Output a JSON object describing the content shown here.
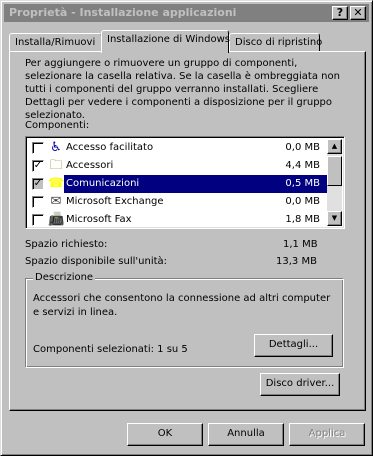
{
  "window": {
    "title": "Proprietà - Installazione applicazioni",
    "help_glyph": "?",
    "close_glyph": "✕"
  },
  "tabs": [
    {
      "label": "Installa/Rimuovi",
      "active": false
    },
    {
      "label": "Installazione di Windows",
      "active": true
    },
    {
      "label": "Disco di ripristino",
      "active": false
    }
  ],
  "intro_text": "Per aggiungere o rimuovere un gruppo di componenti, selezionare la casella relativa. Se la casella è ombreggiata non tutti i componenti del gruppo verranno installati. Scegliere Dettagli per vedere i componenti a disposizione per il gruppo selezionato.",
  "components_label": "Componenti:",
  "components": [
    {
      "name": "Accesso facilitato",
      "size": "0,0 MB",
      "checked": false,
      "icon": "accessibility-icon",
      "glyph": "♿",
      "selected": false
    },
    {
      "name": "Accessori",
      "size": "4,4 MB",
      "checked": true,
      "icon": "folder-icon",
      "glyph": "🗀",
      "selected": false
    },
    {
      "name": "Comunicazioni",
      "size": "0,5 MB",
      "checked": true,
      "icon": "communications-icon",
      "glyph": "☎",
      "selected": true
    },
    {
      "name": "Microsoft Exchange",
      "size": "0,0 MB",
      "checked": false,
      "icon": "exchange-icon",
      "glyph": "✉",
      "selected": false
    },
    {
      "name": "Microsoft Fax",
      "size": "1,8 MB",
      "checked": false,
      "icon": "fax-icon",
      "glyph": "📠",
      "selected": false
    }
  ],
  "check_glyph": "✓",
  "scroll": {
    "up_glyph": "▲",
    "down_glyph": "▼"
  },
  "space": {
    "required_label": "Spazio richiesto:",
    "required_value": "1,1 MB",
    "available_label": "Spazio disponibile sull'unità:",
    "available_value": "13,3 MB"
  },
  "description": {
    "legend": "Descrizione",
    "text": "Accessori che consentono la connessione ad altri computer e servizi in linea.",
    "selected_count": "Componenti selezionati: 1 su 5",
    "details_button": "Dettagli..."
  },
  "disk_button": "Disco driver...",
  "footer": {
    "ok": "OK",
    "cancel": "Annulla",
    "apply": "Applica"
  },
  "colors": {
    "face": "#c0c0c0",
    "selection": "#000080",
    "titlebar_inactive": "#808080"
  }
}
